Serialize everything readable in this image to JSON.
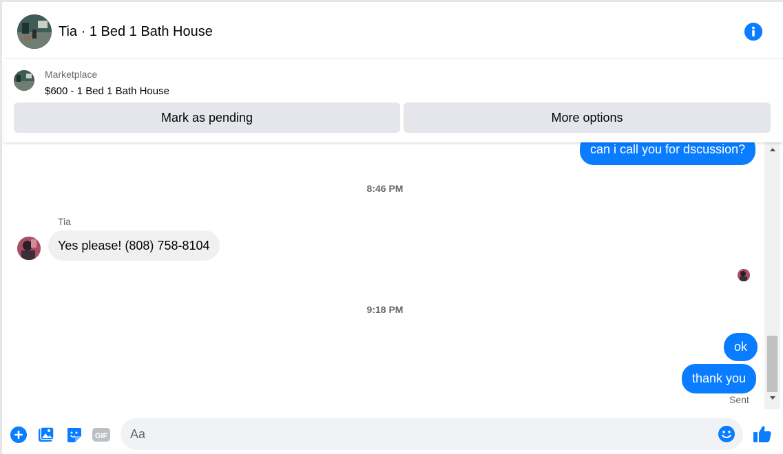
{
  "header": {
    "title": "Tia · 1 Bed 1 Bath House",
    "info_icon": "info-icon"
  },
  "listing": {
    "source": "Marketplace",
    "title": "$600 - 1 Bed 1 Bath House",
    "buttons": {
      "pending": "Mark as pending",
      "more": "More options"
    }
  },
  "thread": {
    "messages": [
      {
        "direction": "out",
        "text": "can i call you for dscussion?"
      },
      {
        "timestamp": "8:46 PM"
      },
      {
        "sender": "Tia",
        "direction": "in",
        "text": "Yes please! (808) 758-8104"
      },
      {
        "timestamp": "9:18 PM"
      },
      {
        "direction": "out",
        "text": "ok"
      },
      {
        "direction": "out",
        "text": "thank you"
      }
    ],
    "status": "Sent"
  },
  "composer": {
    "placeholder": "Aa",
    "icons": [
      "plus-icon",
      "photo-icon",
      "sticker-icon",
      "gif-icon",
      "emoji-icon",
      "thumbs-up-icon"
    ],
    "gif_label": "GIF"
  },
  "colors": {
    "accent": "#0a7cff",
    "bubble_in": "#f0f0f0",
    "button_bg": "#e4e6eb",
    "muted_text": "#65676b"
  }
}
